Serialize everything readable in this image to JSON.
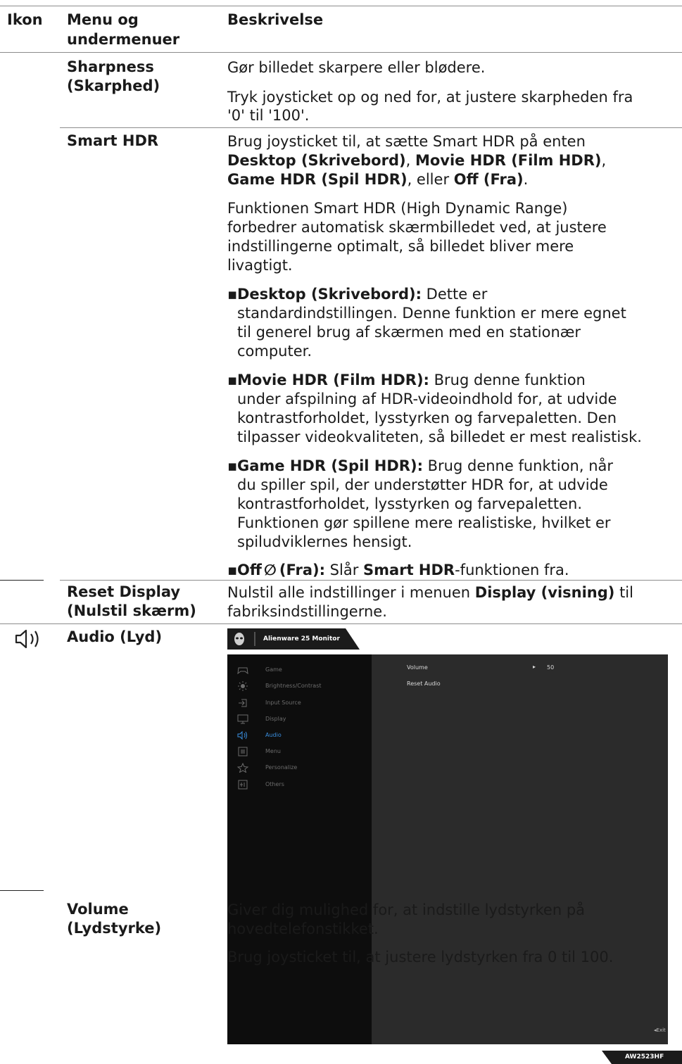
{
  "header": {
    "col1": "Ikon",
    "col2_line1": "Menu og",
    "col2_line2": "undermenuer",
    "col3": "Beskrivelse"
  },
  "sharpness": {
    "name_line1": "Sharpness",
    "name_line2": "(Skarphed)",
    "desc1": "Gør billedet skarpere eller blødere.",
    "desc2_line1": "Tryk joysticket op og ned for, at justere skarpheden fra",
    "desc2_line2": "'0' til '100'."
  },
  "smart_hdr": {
    "name": "Smart HDR",
    "intro_line1": "Brug joysticket til, at sætte Smart HDR på enten",
    "opt_desktop": "Desktop (Skrivebord)",
    "sep1": ", ",
    "opt_movie": "Movie HDR (Film HDR)",
    "sep2": ",",
    "opt_game": "Game HDR (Spil HDR)",
    "sep3": ", eller ",
    "opt_off": "Off (Fra)",
    "end": ".",
    "para2": [
      "Funktionen Smart HDR (High Dynamic Range)",
      "forbedrer automatisk skærmbilledet ved, at justere",
      "indstillingerne optimalt, så billedet bliver mere",
      "livagtigt."
    ],
    "bullets": [
      {
        "label": "Desktop (Skrivebord):",
        "first": " Dette er",
        "lines": [
          "standardindstillingen. Denne funktion er mere egnet",
          "til generel brug af skærmen med en stationær",
          "computer."
        ]
      },
      {
        "label": "Movie HDR (Film HDR):",
        "first": " Brug denne funktion",
        "lines": [
          "under afspilning af HDR-videoindhold for, at udvide",
          "kontrastforholdet, lysstyrken og farvepaletten. Den",
          "tilpasser videokvaliteten, så billedet er mest realistisk."
        ]
      },
      {
        "label": "Game HDR (Spil HDR):",
        "first": " Brug denne funktion, når",
        "lines": [
          "du spiller spil, der understøtter HDR for, at udvide",
          "kontrastforholdet, lysstyrken og farvepaletten.",
          "Funktionen gør spillene mere realistiske, hvilket er",
          "spiludviklernes hensigt."
        ]
      }
    ],
    "off_bullet": {
      "label_a": "Off",
      "label_b": "(Fra):",
      "text_a": " Slår ",
      "text_b": "Smart HDR",
      "text_c": "-funktionen fra."
    }
  },
  "reset_display": {
    "name_line1": "Reset Display",
    "name_line2": "(Nulstil skærm)",
    "desc_a": "Nulstil alle indstillinger i menuen ",
    "desc_b": "Display (visning)",
    "desc_c": " til",
    "desc_line2": "fabriksindstillingerne."
  },
  "audio": {
    "icon": "speaker-icon",
    "name": "Audio (Lyd)"
  },
  "osd": {
    "title": "Alienware 25 Monitor",
    "menu": [
      {
        "label": "Game",
        "icon": "gamepad-icon"
      },
      {
        "label": "Brightness/Contrast",
        "icon": "sun-icon"
      },
      {
        "label": "Input Source",
        "icon": "input-icon"
      },
      {
        "label": "Display",
        "icon": "display-icon"
      },
      {
        "label": "Audio",
        "icon": "speaker-icon"
      },
      {
        "label": "Menu",
        "icon": "menu-icon"
      },
      {
        "label": "Personalize",
        "icon": "star-icon"
      },
      {
        "label": "Others",
        "icon": "others-icon"
      }
    ],
    "active_item": "Audio",
    "volume_label": "Volume",
    "volume_value": "50",
    "reset_audio": "Reset Audio",
    "exit": "Exit",
    "model": "AW2523HF",
    "colors": {
      "accent": "#3a8fe0",
      "menu_bg": "#0d0d0d",
      "body_bg": "#2b2b2b"
    }
  },
  "volume": {
    "name_line1": "Volume",
    "name_line2": "(Lydstyrke)",
    "desc1_line1": "Giver dig mulighed for, at indstille lydstyrken på",
    "desc1_line2": "hovedtelefonstikket.",
    "desc2": "Brug joysticket til, at justere lydstyrken fra 0 til 100."
  }
}
